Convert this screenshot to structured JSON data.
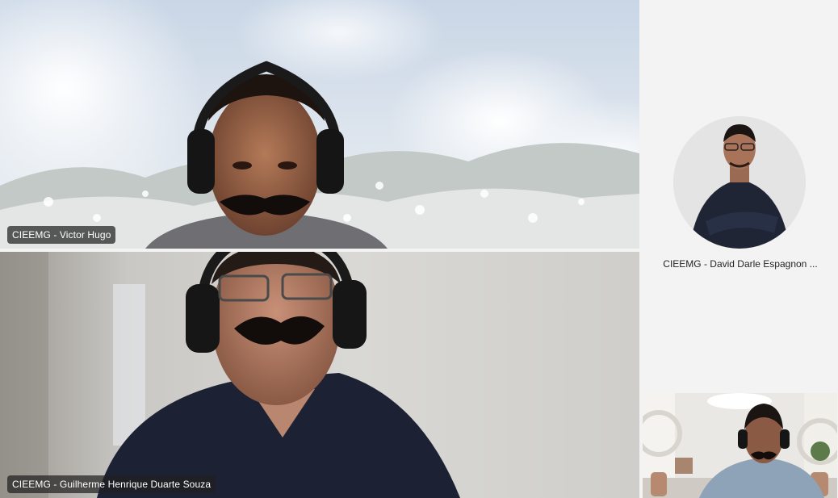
{
  "participants": {
    "victor": {
      "name": "CIEEMG - Victor Hugo"
    },
    "guilherme": {
      "name": "CIEEMG - Guilherme Henrique Duarte Souza"
    },
    "david": {
      "name": "CIEEMG - David Darle Espagnon ..."
    }
  },
  "colors": {
    "panel_background": "#f3f3f3",
    "name_tag_background": "#202020",
    "name_tag_text": "#ffffff",
    "side_name_text": "#242424"
  }
}
